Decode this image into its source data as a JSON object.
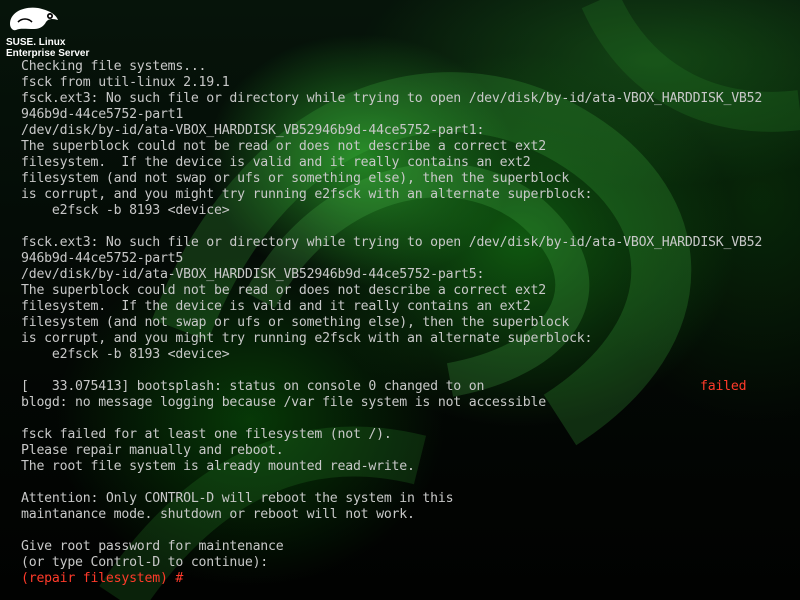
{
  "branding": {
    "logo_icon": "suse-chameleon-icon",
    "line1": "SUSE. Linux",
    "line2": "Enterprise Server"
  },
  "colors": {
    "console_text": "#c8c8c8",
    "error_text": "#ff3a2a",
    "background_accent": "#1f8a1f"
  },
  "console": {
    "lines": [
      "Checking file systems...",
      "fsck from util-linux 2.19.1",
      "fsck.ext3: No such file or directory while trying to open /dev/disk/by-id/ata-VBOX_HARDDISK_VB52",
      "946b9d-44ce5752-part1",
      "/dev/disk/by-id/ata-VBOX_HARDDISK_VB52946b9d-44ce5752-part1:",
      "The superblock could not be read or does not describe a correct ext2",
      "filesystem.  If the device is valid and it really contains an ext2",
      "filesystem (and not swap or ufs or something else), then the superblock",
      "is corrupt, and you might try running e2fsck with an alternate superblock:",
      "    e2fsck -b 8193 <device>",
      "",
      "fsck.ext3: No such file or directory while trying to open /dev/disk/by-id/ata-VBOX_HARDDISK_VB52",
      "946b9d-44ce5752-part5",
      "/dev/disk/by-id/ata-VBOX_HARDDISK_VB52946b9d-44ce5752-part5:",
      "The superblock could not be read or does not describe a correct ext2",
      "filesystem.  If the device is valid and it really contains an ext2",
      "filesystem (and not swap or ufs or something else), then the superblock",
      "is corrupt, and you might try running e2fsck with an alternate superblock:",
      "    e2fsck -b 8193 <device>",
      "",
      "[   33.075413] bootsplash: status on console 0 changed to on",
      "blogd: no message logging because /var file system is not accessible",
      "",
      "fsck failed for at least one filesystem (not /).",
      "Please repair manually and reboot.",
      "The root file system is already mounted read-write.",
      "",
      "Attention: Only CONTROL-D will reboot the system in this",
      "maintanance mode. shutdown or reboot will not work.",
      "",
      "Give root password for maintenance",
      "(or type Control-D to continue):"
    ],
    "status_failed": "failed",
    "prompt": "(repair filesystem) #"
  }
}
